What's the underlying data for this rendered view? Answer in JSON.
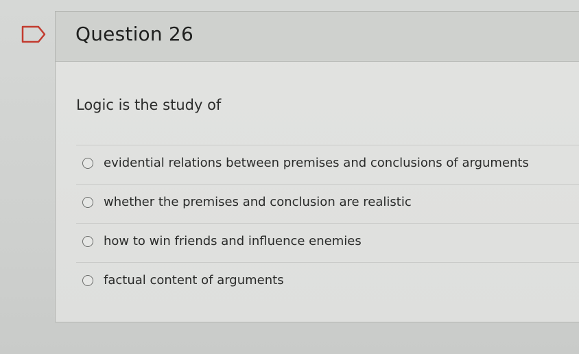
{
  "question": {
    "title": "Question 26",
    "prompt": "Logic is the study of",
    "flag_icon": "flag-outline-icon",
    "answers": [
      {
        "label": "evidential relations between premises and conclusions of arguments",
        "selected": false
      },
      {
        "label": "whether the premises and conclusion are realistic",
        "selected": false
      },
      {
        "label": "how to win friends and influence enemies",
        "selected": false
      },
      {
        "label": "factual content of arguments",
        "selected": false
      }
    ]
  },
  "colors": {
    "background": "#d2d4d2",
    "header": "#cfd1ce",
    "card": "#e0e1df",
    "flag_accent": "#c23b2f"
  }
}
